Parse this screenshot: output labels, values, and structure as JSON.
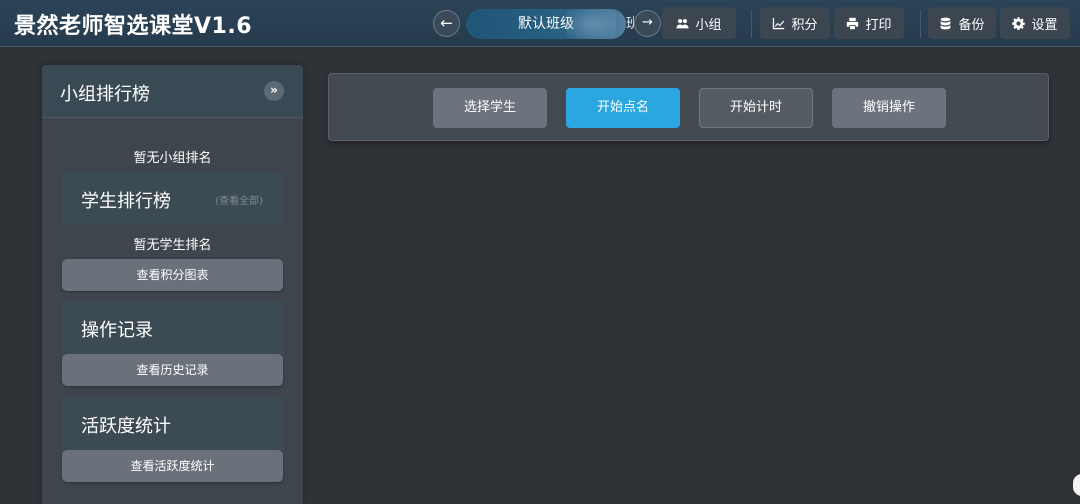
{
  "header": {
    "app_title": "景然老师智选课堂V1.6",
    "class_selector": {
      "prev_label": "←",
      "current": "默认班级",
      "next_peek": "班级",
      "next_label": "→"
    },
    "buttons": {
      "group": "小组",
      "points": "积分",
      "print": "打印",
      "backup": "备份",
      "settings": "设置"
    }
  },
  "sidebar": {
    "title": "小组排行榜",
    "toggle_label": "»",
    "group_ranking_empty": "暂无小组排名",
    "student_ranking": {
      "title": "学生排行榜",
      "view_all": "(查看全部)",
      "empty": "暂无学生排名",
      "chart_button": "查看积分图表"
    },
    "operation_log": {
      "title": "操作记录",
      "button": "查看历史记录"
    },
    "activity": {
      "title": "活跃度统计",
      "button": "查看活跃度统计"
    }
  },
  "toolbar": {
    "select_student": "选择学生",
    "start_roll_call": "开始点名",
    "start_timer": "开始计时",
    "undo": "撤销操作"
  },
  "colors": {
    "accent": "#2aa6e0",
    "header_bg": "#2c4458",
    "page_bg": "#2f3338"
  }
}
